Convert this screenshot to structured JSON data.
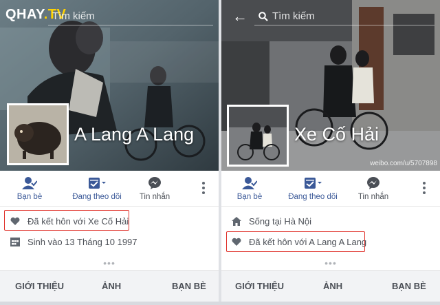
{
  "watermark": {
    "prefix": "QHAY",
    "suffix": ".TV"
  },
  "colors": {
    "facebook_blue": "#3b5998",
    "highlight_red": "#e0322b",
    "text_gray": "#4b4f56"
  },
  "left": {
    "search_placeholder": "Tìm kiếm",
    "profile_name": "A Lang A Lang",
    "actions": {
      "friends": "Bạn bè",
      "following": "Đang theo dõi",
      "message": "Tin nhắn"
    },
    "info": [
      {
        "icon": "heart-icon",
        "text": "Đã kết hôn với Xe Cố Hải"
      },
      {
        "icon": "calendar-icon",
        "text": "Sinh vào 13 Tháng 10 1997"
      }
    ],
    "tabs": {
      "about": "GIỚI THIỆU",
      "photos": "ẢNH",
      "friends": "BẠN BÈ"
    }
  },
  "right": {
    "search_placeholder": "Tìm kiếm",
    "profile_name": "Xe Cố Hải",
    "cover_watermark": "weibo.com/u/5707898",
    "actions": {
      "friends": "Bạn bè",
      "following": "Đang theo dõi",
      "message": "Tin nhắn"
    },
    "info": [
      {
        "icon": "home-icon",
        "text": "Sống tại Hà Nội"
      },
      {
        "icon": "heart-icon",
        "text": "Đã kết hôn với A Lang A Lang"
      }
    ],
    "tabs": {
      "about": "GIỚI THIỆU",
      "photos": "ẢNH",
      "friends": "BẠN BÈ"
    }
  }
}
